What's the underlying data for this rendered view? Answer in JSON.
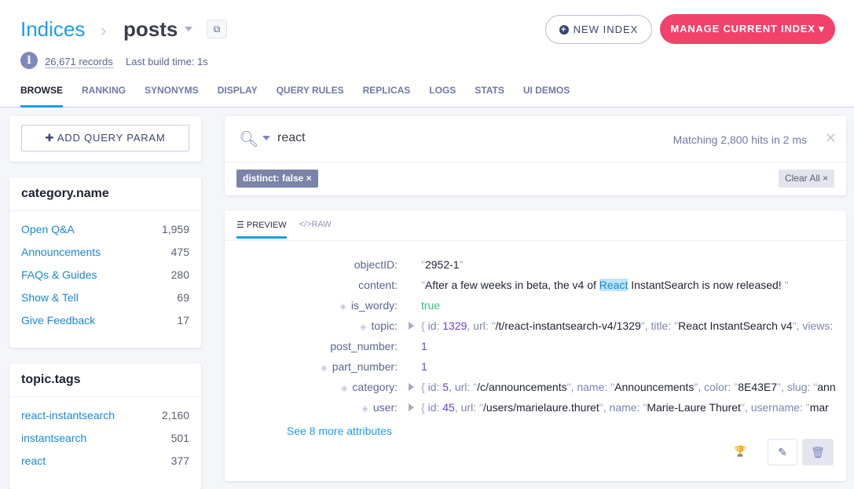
{
  "header": {
    "breadcrumb_root": "Indices",
    "breadcrumb_sep": "›",
    "index_name": "posts",
    "copy_icon": "⧉",
    "records": "26,671 records",
    "build_time": "Last build time: 1s",
    "info_icon": "i",
    "new_index": "NEW INDEX",
    "manage": "MANAGE CURRENT INDEX ▾"
  },
  "tabs": [
    "BROWSE",
    "RANKING",
    "SYNONYMS",
    "DISPLAY",
    "QUERY RULES",
    "REPLICAS",
    "LOGS",
    "STATS",
    "UI DEMOS"
  ],
  "sidebar": {
    "add_query_param": "✚ ADD QUERY PARAM",
    "facets": [
      {
        "title": "category.name",
        "items": [
          {
            "label": "Open Q&A",
            "count": "1,959"
          },
          {
            "label": "Announcements",
            "count": "475"
          },
          {
            "label": "FAQs & Guides",
            "count": "280"
          },
          {
            "label": "Show & Tell",
            "count": "69"
          },
          {
            "label": "Give Feedback",
            "count": "17"
          }
        ]
      },
      {
        "title": "topic.tags",
        "items": [
          {
            "label": "react-instantsearch",
            "count": "2,160"
          },
          {
            "label": "instantsearch",
            "count": "501"
          },
          {
            "label": "react",
            "count": "377"
          }
        ]
      }
    ]
  },
  "search": {
    "query": "react",
    "stats": "Matching 2,800 hits in 2 ms",
    "close": "✕",
    "chip": "distinct: false ×",
    "clear_all": "Clear All ×"
  },
  "result": {
    "tab_preview": "☰ PREVIEW",
    "tab_raw": "</>RAW",
    "see_more": "See 8 more attributes",
    "trophy": "🏆",
    "edit": "✎",
    "delete": "🗑",
    "fields": [
      {
        "label": "objectID:",
        "hidden": false,
        "expand": false,
        "parts": [
          [
            "q",
            "\""
          ],
          [
            "s",
            "2952-1"
          ],
          [
            "q",
            "\""
          ]
        ]
      },
      {
        "label": "content:",
        "hidden": false,
        "expand": false,
        "parts": [
          [
            "q",
            "\""
          ],
          [
            "s",
            "After a few weeks in beta, the v4 of "
          ],
          [
            "hl",
            "React"
          ],
          [
            "s",
            " InstantSearch is now released! "
          ],
          [
            "q",
            "\""
          ]
        ]
      },
      {
        "label": "is_wordy:",
        "hidden": true,
        "expand": false,
        "parts": [
          [
            "b",
            "true"
          ]
        ]
      },
      {
        "label": "topic:",
        "hidden": true,
        "expand": true,
        "parts": [
          [
            "q",
            "{ "
          ],
          [
            "k",
            "id: "
          ],
          [
            "n",
            "1329"
          ],
          [
            "k",
            ", url: "
          ],
          [
            "q",
            "\""
          ],
          [
            "s",
            "/t/react-instantsearch-v4/1329"
          ],
          [
            "q",
            "\""
          ],
          [
            "k",
            ", title: "
          ],
          [
            "q",
            "\""
          ],
          [
            "s",
            "React InstantSearch v4"
          ],
          [
            "q",
            "\""
          ],
          [
            "k",
            ", views: "
          ]
        ]
      },
      {
        "label": "post_number:",
        "hidden": false,
        "expand": false,
        "parts": [
          [
            "n",
            "1"
          ]
        ]
      },
      {
        "label": "part_number:",
        "hidden": true,
        "expand": false,
        "parts": [
          [
            "n",
            "1"
          ]
        ]
      },
      {
        "label": "category:",
        "hidden": true,
        "expand": true,
        "parts": [
          [
            "q",
            "{ "
          ],
          [
            "k",
            "id: "
          ],
          [
            "n",
            "5"
          ],
          [
            "k",
            ", url: "
          ],
          [
            "q",
            "\""
          ],
          [
            "s",
            "/c/announcements"
          ],
          [
            "q",
            "\""
          ],
          [
            "k",
            ", name: "
          ],
          [
            "q",
            "\""
          ],
          [
            "s",
            "Announcements"
          ],
          [
            "q",
            "\""
          ],
          [
            "k",
            ", color: "
          ],
          [
            "q",
            "\""
          ],
          [
            "s",
            "8E43E7"
          ],
          [
            "q",
            "\""
          ],
          [
            "k",
            ", slug: "
          ],
          [
            "q",
            "\""
          ],
          [
            "s",
            "ann"
          ]
        ]
      },
      {
        "label": "user:",
        "hidden": true,
        "expand": true,
        "parts": [
          [
            "q",
            "{ "
          ],
          [
            "k",
            "id: "
          ],
          [
            "n",
            "45"
          ],
          [
            "k",
            ", url: "
          ],
          [
            "q",
            "\""
          ],
          [
            "s",
            "/users/marielaure.thuret"
          ],
          [
            "q",
            "\""
          ],
          [
            "k",
            ", name: "
          ],
          [
            "q",
            "\""
          ],
          [
            "s",
            "Marie-Laure Thuret"
          ],
          [
            "q",
            "\""
          ],
          [
            "k",
            ", username: "
          ],
          [
            "q",
            "\""
          ],
          [
            "s",
            "mar"
          ]
        ]
      }
    ]
  }
}
